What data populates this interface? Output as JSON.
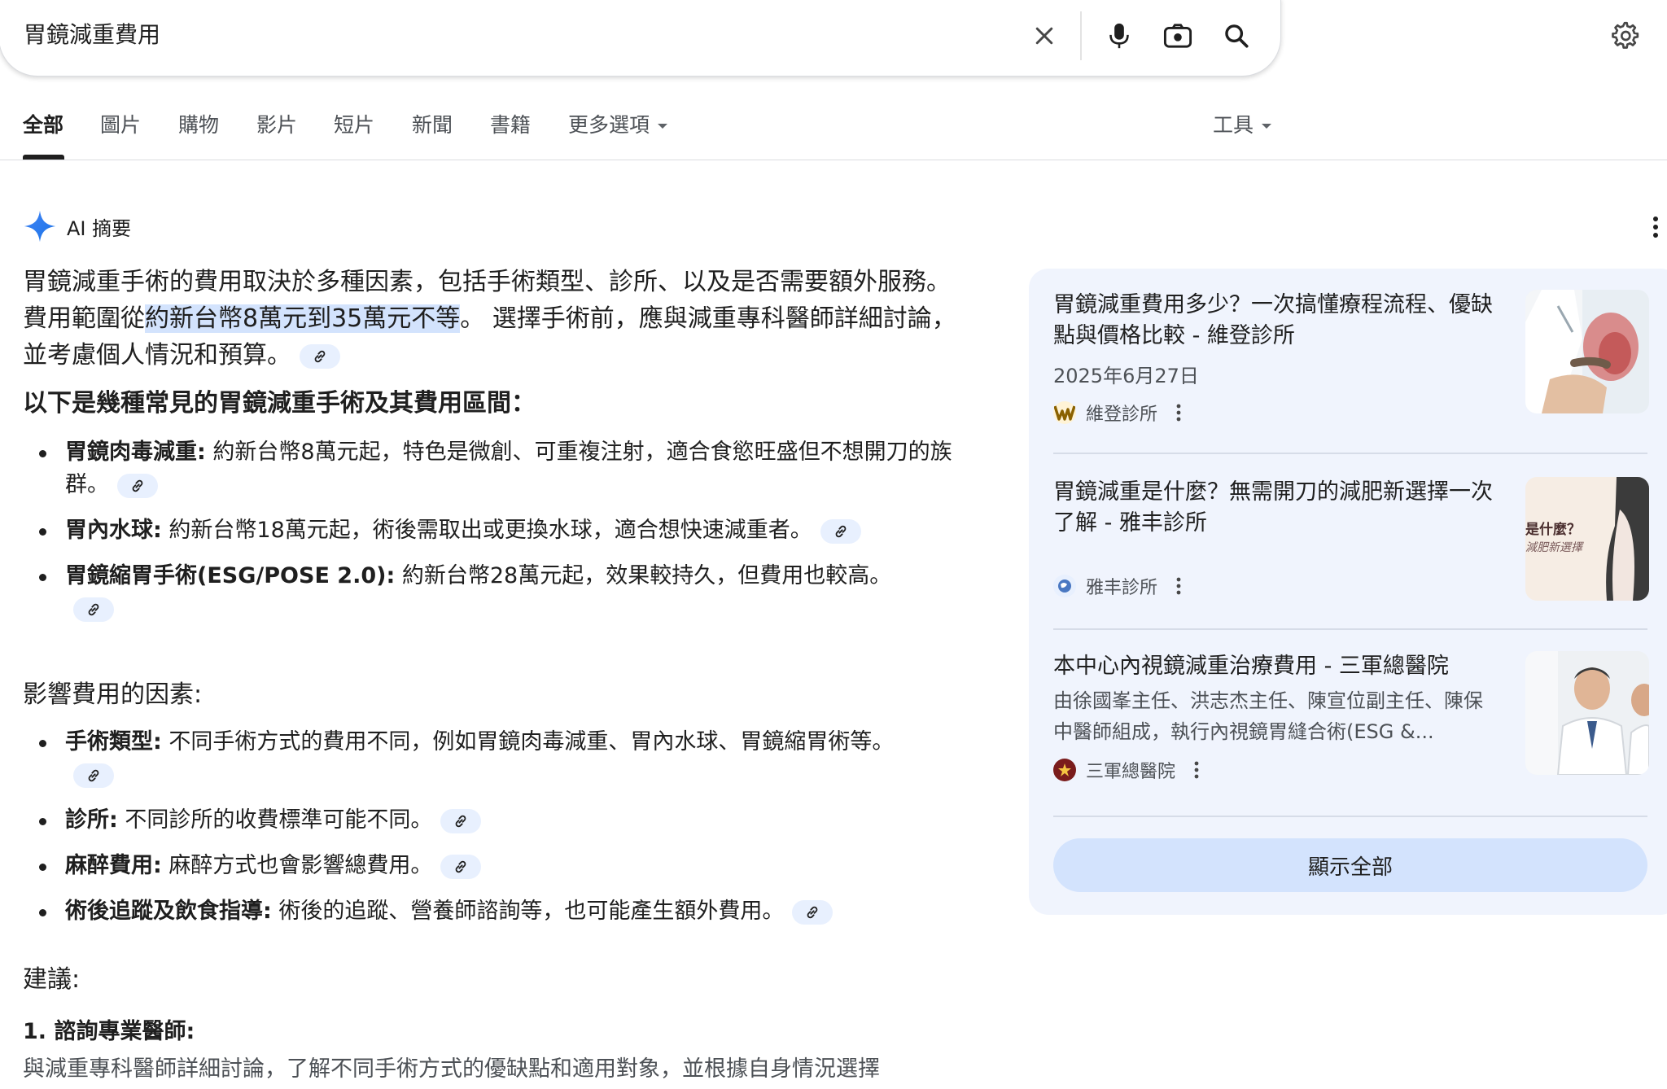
{
  "search": {
    "query": "胃鏡減重費用"
  },
  "tabs": [
    {
      "label": "全部",
      "active": true
    },
    {
      "label": "圖片"
    },
    {
      "label": "購物"
    },
    {
      "label": "影片"
    },
    {
      "label": "短片"
    },
    {
      "label": "新聞"
    },
    {
      "label": "書籍"
    },
    {
      "label": "更多選項"
    }
  ],
  "tools_label": "工具",
  "ai": {
    "title": "AI 摘要",
    "intro_1": "胃鏡減重手術的費用取決於多種因素，包括手術類型、診所、以及是否需要額外服務。 費用範圍從",
    "intro_highlight": "約新台幣8萬元到35萬元不等",
    "intro_2": "。 選擇手術前，應與減重專科醫師詳細討論，並考慮個人情況和預算。",
    "section1_title": "以下是幾種常見的胃鏡減重手術及其費用區間：",
    "procedures": [
      {
        "name": "胃鏡肉毒減重:",
        "text": " 約新台幣8萬元起，特色是微創、可重複注射，適合食慾旺盛但不想開刀的族群。"
      },
      {
        "name": "胃內水球:",
        "text": " 約新台幣18萬元起，術後需取出或更換水球，適合想快速減重者。"
      },
      {
        "name": "胃鏡縮胃手術(ESG/POSE 2.0):",
        "text": " 約新台幣28萬元起，效果較持久，但費用也較高。"
      }
    ],
    "section2_title": "影響費用的因素:",
    "factors": [
      {
        "name": "手術類型:",
        "text": " 不同手術方式的費用不同，例如胃鏡肉毒減重、胃內水球、胃鏡縮胃術等。"
      },
      {
        "name": "診所:",
        "text": " 不同診所的收費標準可能不同。"
      },
      {
        "name": "麻醉費用:",
        "text": " 麻醉方式也會影響總費用。"
      },
      {
        "name": "術後追蹤及飲食指導:",
        "text": " 術後的追蹤、營養師諮詢等，也可能產生額外費用。"
      }
    ],
    "section3_title": "建議:",
    "advice_1_title": "1. 諮詢專業醫師:",
    "advice_1_text": "與減重專科醫師詳細討論，了解不同手術方式的優缺點和適用對象，並根據自身情況選擇"
  },
  "sources": [
    {
      "title": "胃鏡減重費用多少？一次搞懂療程流程、優缺點與價格比較 - 維登診所",
      "date": "2025年6月27日",
      "site": "維登診所"
    },
    {
      "title": "胃鏡減重是什麼？無需開刀的減肥新選擇一次了解 - 雅丰診所",
      "site": "雅丰診所",
      "thumb_text_1": "是什麼？",
      "thumb_text_2": "減肥新選擇"
    },
    {
      "title": "本中心內視鏡減重治療費用 - 三軍總醫院",
      "snippet": "由徐國峯主任、洪志杰主任、陳宣位副主任、陳保中醫師組成，執行內視鏡胃縫合術(ESG &...",
      "site": "三軍總醫院"
    }
  ],
  "show_all_label": "顯示全部",
  "colors": {
    "link_chip": "#e8f0fe",
    "highlight": "#d3e3fd",
    "panel_bg": "#f0f4fd",
    "accent_blue": "#4285f4"
  }
}
